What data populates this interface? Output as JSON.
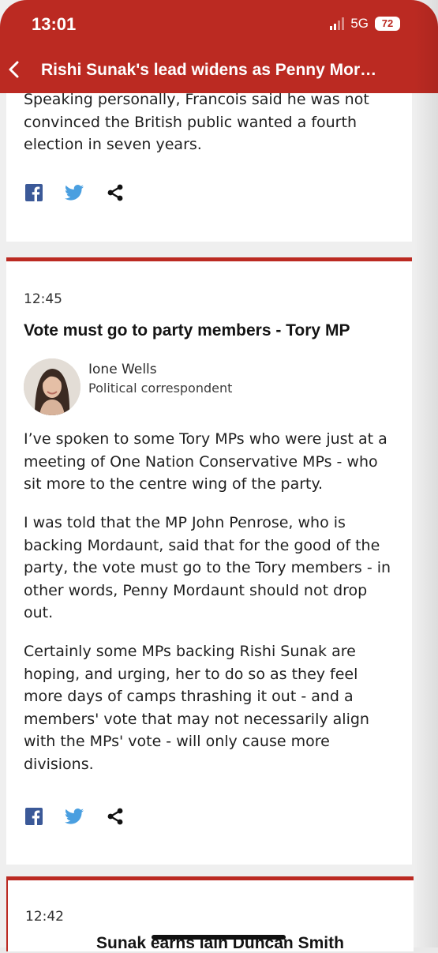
{
  "status_bar": {
    "time": "13:01",
    "network": "5G",
    "battery": "72"
  },
  "header": {
    "title": "Rishi Sunak's lead widens as Penny Mor…"
  },
  "card1": {
    "text": "Speaking personally, Francois said he was not convinced the British public wanted a fourth election in seven years."
  },
  "card2": {
    "time": "12:45",
    "title": "Vote must go to party members - Tory MP",
    "author_name": "Ione Wells",
    "author_role": "Political correspondent",
    "paragraphs": [
      "I’ve spoken to some Tory MPs who were just at a meeting of One Nation Conservative MPs - who sit more to the centre wing of the party.",
      "I was told that the MP John Penrose, who is backing Mordaunt, said that for the good of the party, the vote must go to the Tory members - in other words, Penny Mordaunt should not drop out.",
      "Certainly some MPs backing Rishi Sunak are hoping, and urging, her to do so as they feel more days of camps thrashing it out - and a members' vote that may not necessarily align with the MPs' vote - will only cause more divisions."
    ]
  },
  "card3": {
    "time": "12:42",
    "title": "Sunak earns Iain Duncan Smith"
  },
  "colors": {
    "brand": "#bb2a22",
    "facebook": "#3b5998",
    "twitter": "#4a9fe0"
  }
}
